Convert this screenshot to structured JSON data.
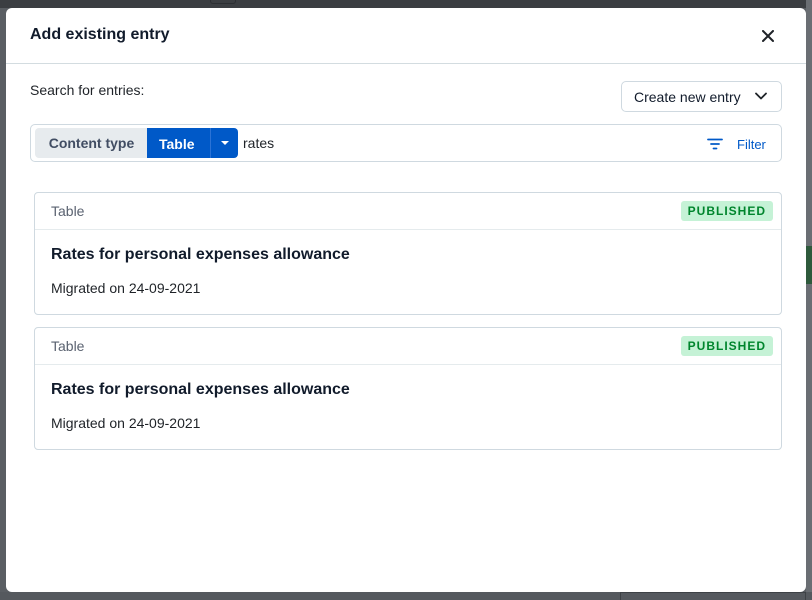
{
  "modal": {
    "title": "Add existing entry",
    "close_icon": "close-icon"
  },
  "search": {
    "label": "Search for entries:",
    "create_button_label": "Create new entry",
    "content_type_label": "Content type",
    "content_type_value": "Table",
    "query": "rates",
    "filter_label": "Filter"
  },
  "entries": [
    {
      "type": "Table",
      "status": "PUBLISHED",
      "title": "Rates for personal expenses allowance",
      "description": "Migrated on 24-09-2021"
    },
    {
      "type": "Table",
      "status": "PUBLISHED",
      "title": "Rates for personal expenses allowance",
      "description": "Migrated on 24-09-2021"
    }
  ],
  "colors": {
    "accent": "#0059c8",
    "published_bg": "#c5f2d6",
    "published_text": "#00852d"
  }
}
